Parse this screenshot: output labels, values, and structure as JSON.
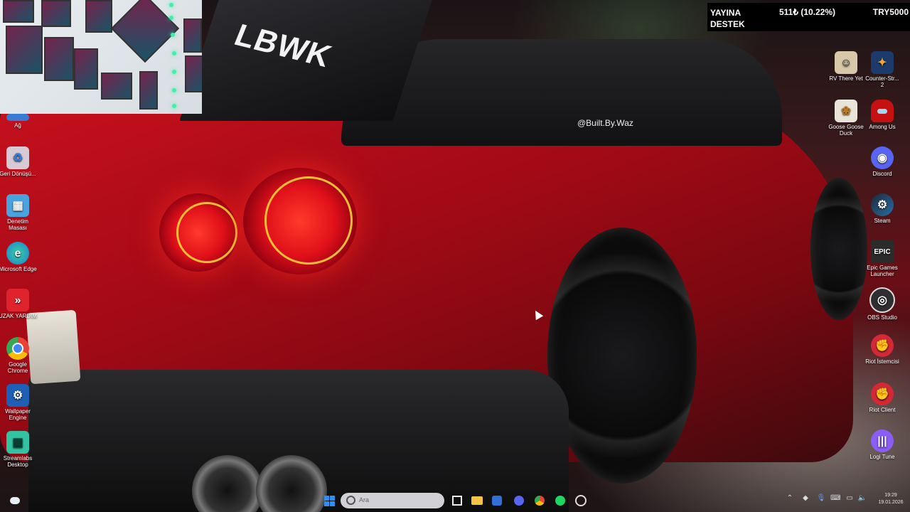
{
  "stream_overlay": {
    "label_line1": "YAYINA",
    "label_line2": "DESTEK",
    "amount": "511₺ (10.22%)",
    "goal": "TRY5000"
  },
  "wallpaper": {
    "wing_text": "LBWK",
    "decal_text": "@Built.By.Waz"
  },
  "desktop_left": [
    {
      "label": "Ağ",
      "icon": "network-icon"
    },
    {
      "label": "Geri Dönüşü...",
      "icon": "recycle-bin-icon"
    },
    {
      "label": "Denetim Masası",
      "icon": "control-panel-icon"
    },
    {
      "label": "Microsoft Edge",
      "icon": "edge-icon"
    },
    {
      "label": "UZAK YARDIM",
      "icon": "remote-help-icon"
    },
    {
      "label": "Google Chrome",
      "icon": "chrome-icon"
    },
    {
      "label": "Wallpaper Engine",
      "icon": "wallpaper-engine-icon"
    },
    {
      "label": "Streamlabs Desktop",
      "icon": "streamlabs-icon"
    }
  ],
  "desktop_right": [
    {
      "label": "RV There Yet",
      "icon": "rv-there-yet-icon"
    },
    {
      "label": "Counter-Str... 2",
      "icon": "counter-strike-icon"
    },
    {
      "label": "Goose Goose Duck",
      "icon": "goose-goose-duck-icon"
    },
    {
      "label": "Among Us",
      "icon": "among-us-icon"
    },
    {
      "label": "Discord",
      "icon": "discord-icon"
    },
    {
      "label": "Steam",
      "icon": "steam-icon"
    },
    {
      "label": "Epic Games Launcher",
      "icon": "epic-games-icon"
    },
    {
      "label": "OBS Studio",
      "icon": "obs-icon"
    },
    {
      "label": "Riot İstemcisi",
      "icon": "riot-client-icon"
    },
    {
      "label": "Riot Client",
      "icon": "riot-client-icon"
    },
    {
      "label": "Logi Tune",
      "icon": "logi-tune-icon"
    }
  ],
  "taskbar": {
    "search_placeholder": "Ara",
    "time": "19:29",
    "date": "19.01.2026"
  },
  "colors": {
    "accent": "#c8101e",
    "overlay_bg": "#000000",
    "discord": "#5865f2",
    "riot": "#d32936",
    "logi": "#8b5cf6"
  }
}
